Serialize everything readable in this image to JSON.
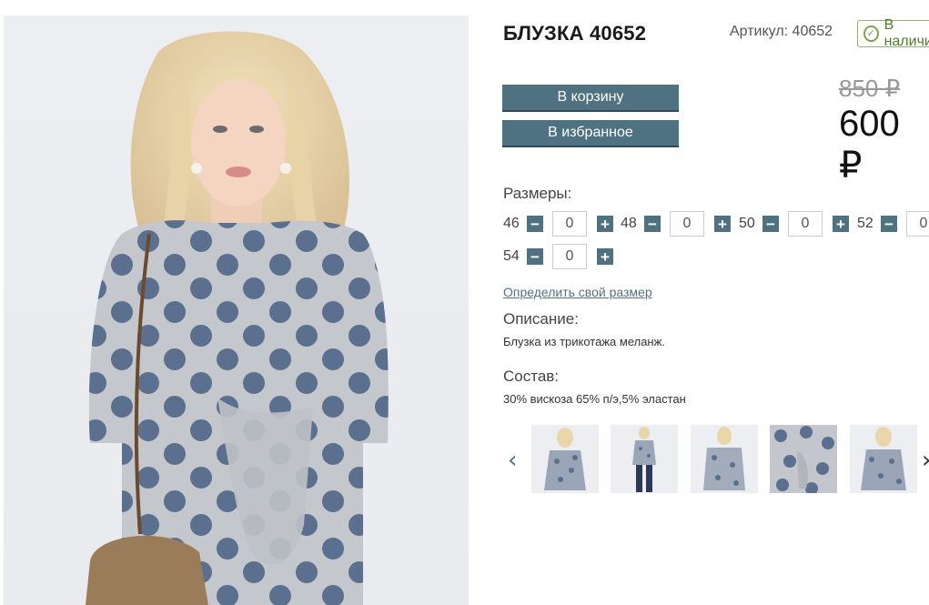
{
  "product": {
    "title": "БЛУЗКА 40652",
    "sku": "Артикул: 40652",
    "stock": "В наличии"
  },
  "prices": {
    "old": "850 ₽",
    "new": "600 ₽"
  },
  "buttons": {
    "cart": "В корзину",
    "favorites": "В избранное"
  },
  "sizes": {
    "label": "Размеры:",
    "items": [
      {
        "size": "46",
        "qty": "0"
      },
      {
        "size": "48",
        "qty": "0"
      },
      {
        "size": "50",
        "qty": "0"
      },
      {
        "size": "52",
        "qty": "0"
      },
      {
        "size": "54",
        "qty": "0"
      }
    ],
    "minus": "−",
    "plus": "+",
    "link": "Определить свой размер"
  },
  "description": {
    "label": "Описание:",
    "text": "Блузка из трикотажа меланж."
  },
  "composition": {
    "label": "Состав:",
    "text": "30% вискоза 65% п/э,5% эластан"
  },
  "gallery": {
    "prev": "‹",
    "next": "›",
    "thumb_count": 5
  },
  "colors": {
    "accent": "#4f7282",
    "stock_green": "#7aa54c",
    "fabric": "#c9ccd1",
    "dots": "#5b6f8e"
  }
}
